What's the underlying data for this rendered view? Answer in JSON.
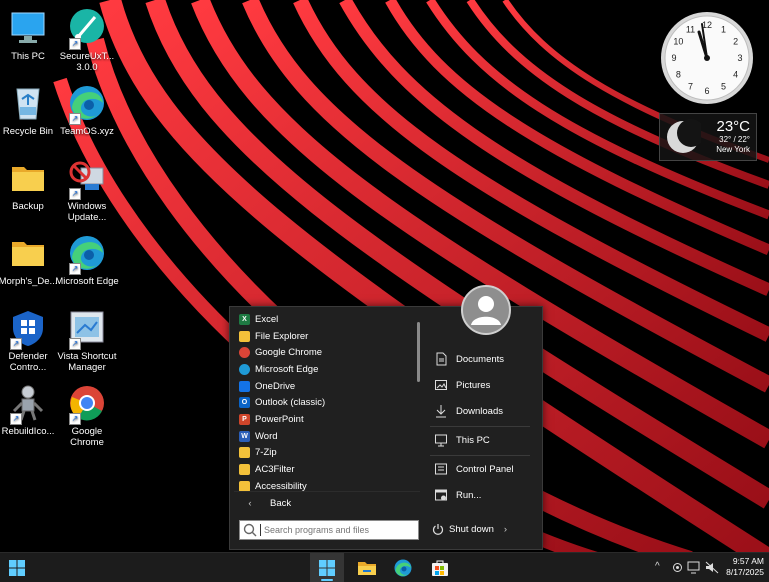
{
  "desktop": {
    "icons": [
      {
        "label": "This PC",
        "icon": "monitor-icon"
      },
      {
        "label": "SecureUxT... 3.0.0",
        "icon": "brush-icon"
      },
      {
        "label": "Recycle Bin",
        "icon": "recycle-bin-icon"
      },
      {
        "label": "TeamOS.xyz",
        "icon": "edge-icon"
      },
      {
        "label": "Backup",
        "icon": "folder-icon"
      },
      {
        "label": "Windows Update...",
        "icon": "windows-update-icon"
      },
      {
        "label": "Morph's_De...",
        "icon": "folder-icon"
      },
      {
        "label": "Microsoft Edge",
        "icon": "edge-icon"
      },
      {
        "label": "Defender Contro...",
        "icon": "defender-icon"
      },
      {
        "label": "Vista Shortcut Manager",
        "icon": "shortcut-manager-icon"
      },
      {
        "label": "RebuildIco...",
        "icon": "robot-icon"
      },
      {
        "label": "Google Chrome",
        "icon": "chrome-icon"
      }
    ]
  },
  "gadgets": {
    "clock": {
      "numbers": [
        "12",
        "1",
        "2",
        "3",
        "4",
        "5",
        "6",
        "7",
        "8",
        "9",
        "10",
        "11"
      ]
    },
    "weather": {
      "temperature": "23°C",
      "high_low": "32° / 22°",
      "city": "New York",
      "icon": "moon-icon"
    }
  },
  "start_menu": {
    "programs": [
      {
        "label": "Excel",
        "icon": "excel-icon",
        "color": "#1e7a43",
        "letter": "X"
      },
      {
        "label": "File Explorer",
        "icon": "folder-icon",
        "color": "#f3c13a",
        "letter": ""
      },
      {
        "label": "Google Chrome",
        "icon": "chrome-icon",
        "color": "#db4437",
        "letter": ""
      },
      {
        "label": "Microsoft Edge",
        "icon": "edge-icon",
        "color": "#1f9ad6",
        "letter": ""
      },
      {
        "label": "OneDrive",
        "icon": "cloud-icon",
        "color": "#1473e6",
        "letter": ""
      },
      {
        "label": "Outlook (classic)",
        "icon": "outlook-icon",
        "color": "#0a64c8",
        "letter": "O"
      },
      {
        "label": "PowerPoint",
        "icon": "powerpoint-icon",
        "color": "#d0452a",
        "letter": "P"
      },
      {
        "label": "Word",
        "icon": "word-icon",
        "color": "#2a5eb8",
        "letter": "W"
      },
      {
        "label": "7-Zip",
        "icon": "folder-icon",
        "color": "#f3c13a",
        "letter": ""
      },
      {
        "label": "AC3Filter",
        "icon": "folder-icon",
        "color": "#f3c13a",
        "letter": ""
      },
      {
        "label": "Accessibility",
        "icon": "folder-icon",
        "color": "#f3c13a",
        "letter": ""
      }
    ],
    "back_label": "Back",
    "search_placeholder": "Search programs and files",
    "right_items": {
      "documents": "Documents",
      "pictures": "Pictures",
      "downloads": "Downloads",
      "this_pc": "This PC",
      "control_panel": "Control Panel",
      "run": "Run..."
    },
    "shutdown_label": "Shut down",
    "shutdown_arrow": "›"
  },
  "taskbar": {
    "pinned": [
      "start-icon",
      "file-explorer-icon",
      "edge-icon",
      "store-icon"
    ],
    "tray_chevron": "^",
    "time": "9:57 AM",
    "date": "8/17/2025"
  },
  "colors": {
    "accent": "#60cdff",
    "wallpaper_red": "#d61f2c",
    "menu_bg": "#202020",
    "taskbar_bg": "#1c1c1c"
  }
}
